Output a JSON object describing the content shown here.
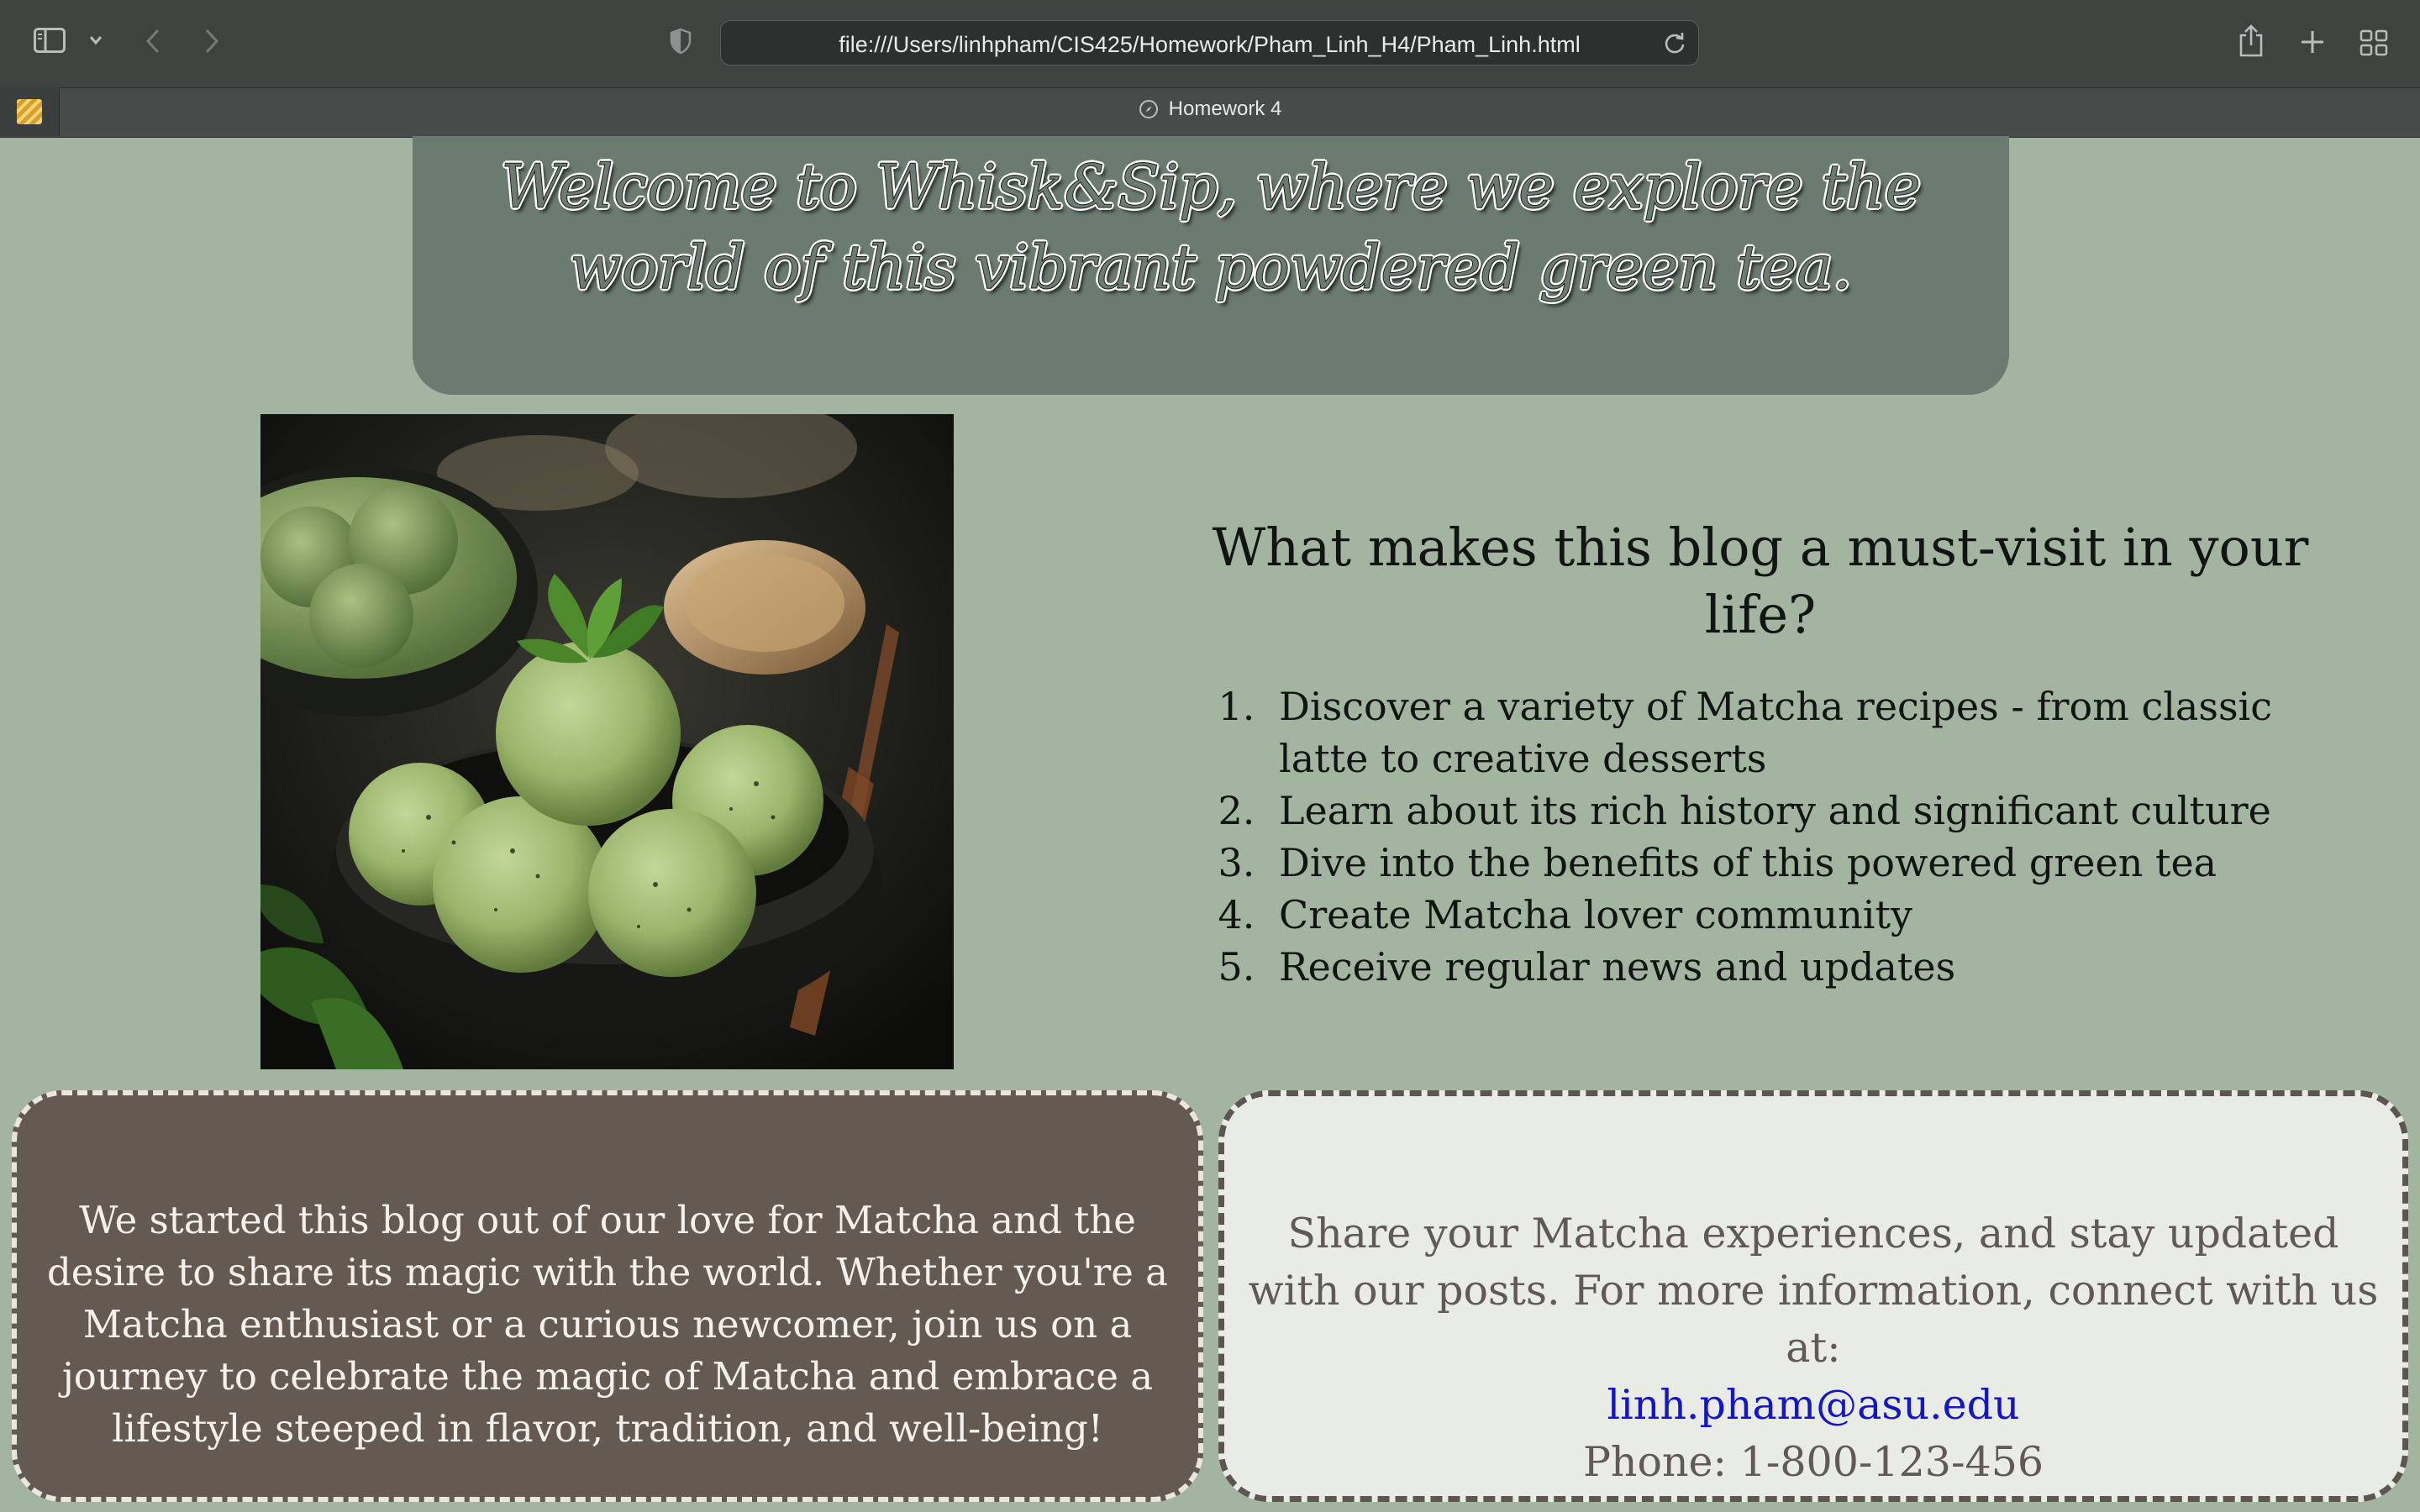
{
  "browser": {
    "url": "file:///Users/linhpham/CIS425/Homework/Pham_Linh_H4/Pham_Linh.html",
    "tab_title": "Homework 4"
  },
  "header": {
    "title": "Welcome to Whisk&Sip, where we explore the world of this vibrant powdered green tea."
  },
  "intro": {
    "heading": "What makes this blog a must-visit in your life?",
    "items": [
      "Discover a variety of Matcha recipes - from classic latte to creative desserts",
      "Learn about its rich history and significant culture",
      "Dive into the benefits of this powered green tea",
      "Create Matcha lover community",
      "Receive regular news and updates"
    ]
  },
  "story": {
    "text": "We started this blog out of our love for Matcha and the desire to share its magic with the world. Whether you're a Matcha enthusiast or a curious newcomer, join us on a journey to celebrate the magic of Matcha and embrace a lifestyle steeped in flavor, tradition, and well-being!"
  },
  "contact": {
    "text": "Share your Matcha experiences, and stay updated with our posts. For more information, connect with us at:",
    "email": "linh.pham@asu.edu",
    "phone": "Phone: 1-800-123-456"
  },
  "colors": {
    "page_bg": "#a3b5a1",
    "header_bg": "#6b7b70",
    "story_bg": "#645a52",
    "contact_bg": "#e9ebe5",
    "link": "#1414c8"
  },
  "icons": [
    "sidebar-icon",
    "chevron-down-icon",
    "back-arrow-icon",
    "forward-arrow-icon",
    "privacy-shield-icon",
    "reload-icon",
    "share-icon",
    "plus-icon",
    "tab-overview-icon",
    "compass-icon",
    "matcha-photo"
  ]
}
